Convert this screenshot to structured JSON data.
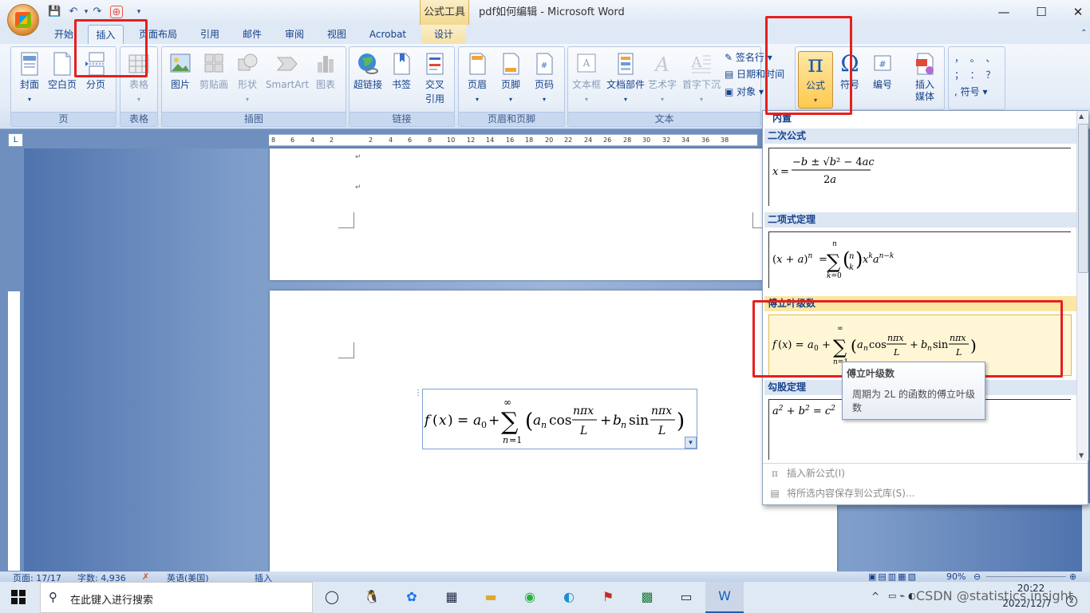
{
  "window": {
    "context_tools": "公式工具",
    "title": "pdf如何编辑 - Microsoft Word",
    "controls": {
      "minimize": "—",
      "maximize": "☐",
      "close": "✕"
    }
  },
  "tabs": [
    "开始",
    "插入",
    "页面布局",
    "引用",
    "邮件",
    "审阅",
    "视图",
    "Acrobat",
    "设计"
  ],
  "ribbon": {
    "groups": {
      "page": "页",
      "table": "表格",
      "illustrations": "插图",
      "links": "链接",
      "header_footer": "页眉和页脚",
      "text": "文本"
    },
    "page_buttons": [
      "封面",
      "空白页",
      "分页"
    ],
    "table_button": "表格",
    "illustration_buttons": [
      "图片",
      "剪贴画",
      "形状",
      "SmartArt",
      "图表"
    ],
    "link_buttons": [
      "超链接",
      "书签",
      "交叉",
      "引用"
    ],
    "hf_buttons": [
      "页眉",
      "页脚",
      "页码"
    ],
    "text_buttons": [
      "文本框",
      "文档部件",
      "艺术字",
      "首字下沉"
    ],
    "text_small": [
      "签名行",
      "日期和时间",
      "对象"
    ],
    "symbol_buttons": {
      "equation": "公式",
      "symbol": "符号",
      "numbering": "编号",
      "insert": "插入",
      "media": "媒体"
    },
    "punct": {
      "a": "，",
      "b": "。",
      "c": "、",
      "d": "；",
      "e": "：",
      "f": "？",
      "g": "符号"
    }
  },
  "gallery": {
    "header": "内置",
    "sections": [
      "二次公式",
      "二项式定理",
      "傅立叶级数",
      "勾股定理"
    ],
    "footer": {
      "insert_new": "插入新公式(I)",
      "save_selection": "将所选内容保存到公式库(S)..."
    }
  },
  "tooltip": {
    "title": "傅立叶级数",
    "body": "周期为 2L 的函数的傅立叶级数"
  },
  "ruler": {
    "ticks": [
      "8",
      "6",
      "4",
      "2",
      "",
      "2",
      "4",
      "6",
      "8",
      "10",
      "12",
      "14",
      "16",
      "18",
      "20",
      "22",
      "24",
      "26",
      "28",
      "30",
      "32",
      "34",
      "36",
      "38"
    ]
  },
  "status": {
    "page": "页面: 17/17",
    "words": "字数: 4,936",
    "language": "英语(美国)",
    "mode": "插入",
    "zoom": "90%"
  },
  "taskbar": {
    "search_placeholder": "在此键入进行搜索",
    "time": "20:22",
    "date": "2022/12/7",
    "watermark": "CSDN @statistics.insight"
  }
}
